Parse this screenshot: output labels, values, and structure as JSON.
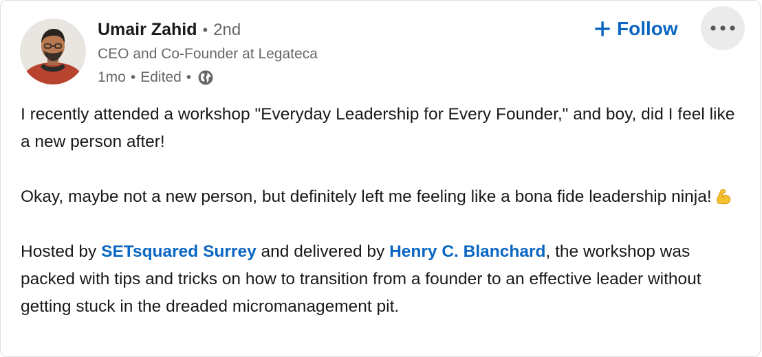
{
  "author": {
    "name": "Umair Zahid",
    "connection_degree": "2nd",
    "separator": "•",
    "headline": "CEO and Co-Founder at Legateca",
    "post_age": "1mo",
    "edited_label": "Edited",
    "visibility_icon": "globe-icon",
    "avatar_icon": "profile-photo"
  },
  "actions": {
    "follow_label": "Follow",
    "follow_icon": "plus-icon",
    "more_icon": "ellipsis-icon"
  },
  "post": {
    "p1": "I recently attended a workshop \"Everyday Leadership for Every Founder,\" and boy, did I feel like a new person after!",
    "p2": "Okay, maybe not a new person, but definitely left me feeling like a bona fide leadership ninja!",
    "p2_emoji": "flexed-biceps-emoji",
    "p3_before": "Hosted by ",
    "mention1": "SETsquared Surrey",
    "p3_middle": " and delivered by ",
    "mention2": "Henry C. Blanchard",
    "p3_after": ", the workshop was packed with tips and tricks on how to transition from a founder to an effective leader without getting stuck in the dreaded micromanagement pit."
  },
  "colors": {
    "link": "#0a66c2",
    "text": "#1f1f1f",
    "muted": "#666666",
    "more_bg": "#ebebeb"
  }
}
